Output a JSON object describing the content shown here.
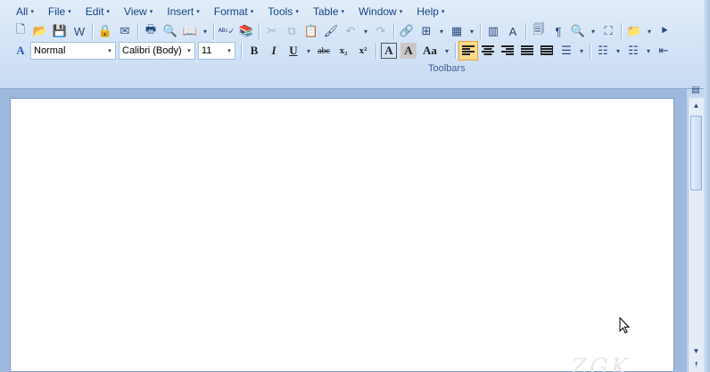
{
  "menu": [
    {
      "label": "All"
    },
    {
      "label": "File"
    },
    {
      "label": "Edit"
    },
    {
      "label": "View"
    },
    {
      "label": "Insert"
    },
    {
      "label": "Format"
    },
    {
      "label": "Tools"
    },
    {
      "label": "Table"
    },
    {
      "label": "Window"
    },
    {
      "label": "Help"
    }
  ],
  "menu_arrow": "▾",
  "toolbar1": {
    "icons": {
      "new": "🗋",
      "open": "📂",
      "save": "💾",
      "word": "W",
      "permission": "🔒",
      "email": "✉",
      "print": "🖶",
      "print_preview": "🔍",
      "research_pane": "📖",
      "spelling": "ᴬᴮᶜ✓",
      "research": "📚",
      "cut": "✂",
      "copy": "⧉",
      "paste": "📋",
      "format_painter": "🖌",
      "undo": "↶",
      "redo": "↷",
      "hyperlink": "🔗",
      "borders": "⊞",
      "insert_table": "▦",
      "columns": "▥",
      "drawing": "A",
      "doc_map": "🗐",
      "show_hide": "¶",
      "zoom": "🔍",
      "full_screen": "⛶",
      "folder": "📁",
      "more": "⯈"
    }
  },
  "toolbar2": {
    "style": "Normal",
    "font": "Calibri (Body)",
    "size": "11",
    "styles_icon": "A",
    "bold": "B",
    "italic": "I",
    "underline": "U",
    "strikethrough": "abc",
    "subscript": "x₂",
    "superscript": "x²",
    "text_effect": "A",
    "highlight": "A",
    "change_case": "Aa",
    "line_spacing": "☰",
    "bullets": "☷",
    "numbering": "☷",
    "decrease_indent": "⇤"
  },
  "toolbars_label": "Toolbars",
  "watermark": "ZGK"
}
